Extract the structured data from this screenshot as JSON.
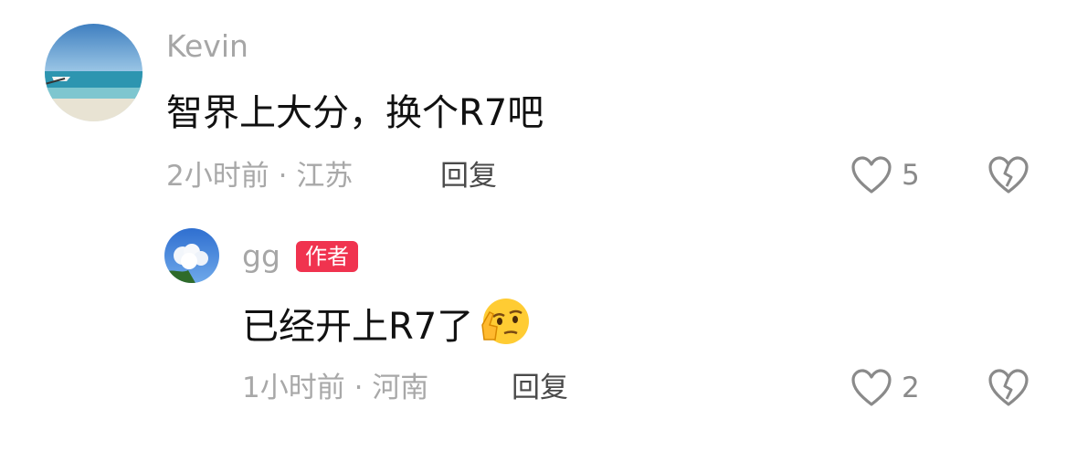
{
  "colors": {
    "author_badge_bg": "#f0334f",
    "username": "#a6a6a6",
    "meta": "#a8a8a8",
    "comment_text": "#111111"
  },
  "comments": [
    {
      "username": "Kevin",
      "text": "智界上大分，换个R7吧",
      "time": "2小时前",
      "location": "江苏",
      "reply_label": "回复",
      "like_count": "5",
      "like_icon": "heart-outline-icon",
      "dislike_icon": "broken-heart-icon",
      "avatar": "beach-boat-avatar"
    },
    {
      "username": "gg",
      "badge": "作者",
      "text": "已经开上R7了",
      "emoji": "thinking-face-emoji",
      "time": "1小时前",
      "location": "河南",
      "reply_label": "回复",
      "like_count": "2",
      "like_icon": "heart-outline-icon",
      "dislike_icon": "broken-heart-icon",
      "avatar": "sky-clouds-avatar"
    }
  ]
}
